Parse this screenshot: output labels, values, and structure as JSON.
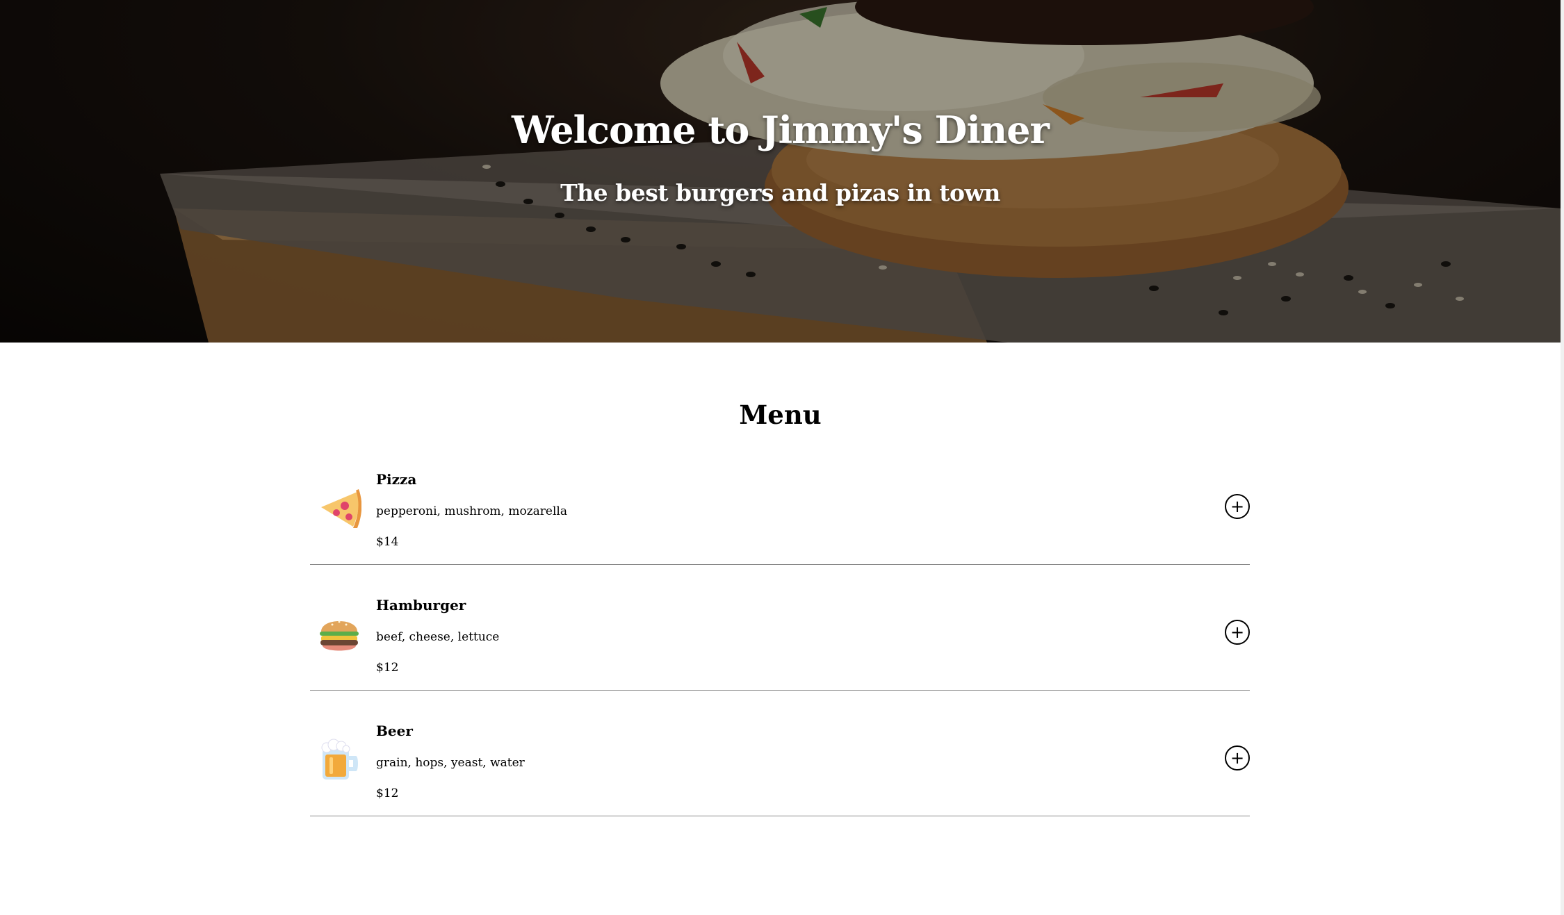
{
  "hero": {
    "title": "Welcome to Jimmy's Diner",
    "subtitle": "The best burgers and pizas in town"
  },
  "menu": {
    "title": "Menu",
    "add_label": "+",
    "items": [
      {
        "name": "Pizza",
        "ingredients": "pepperoni, mushrom, mozarella",
        "price": "$14",
        "icon": "pizza-icon"
      },
      {
        "name": "Hamburger",
        "ingredients": "beef, cheese, lettuce",
        "price": "$12",
        "icon": "hamburger-icon"
      },
      {
        "name": "Beer",
        "ingredients": "grain, hops, yeast, water",
        "price": "$12",
        "icon": "beer-icon"
      }
    ]
  },
  "colors": {
    "hero_dark": "#0b0806",
    "bun": "#b07a3f",
    "divider": "#888888",
    "text": "#000000"
  }
}
